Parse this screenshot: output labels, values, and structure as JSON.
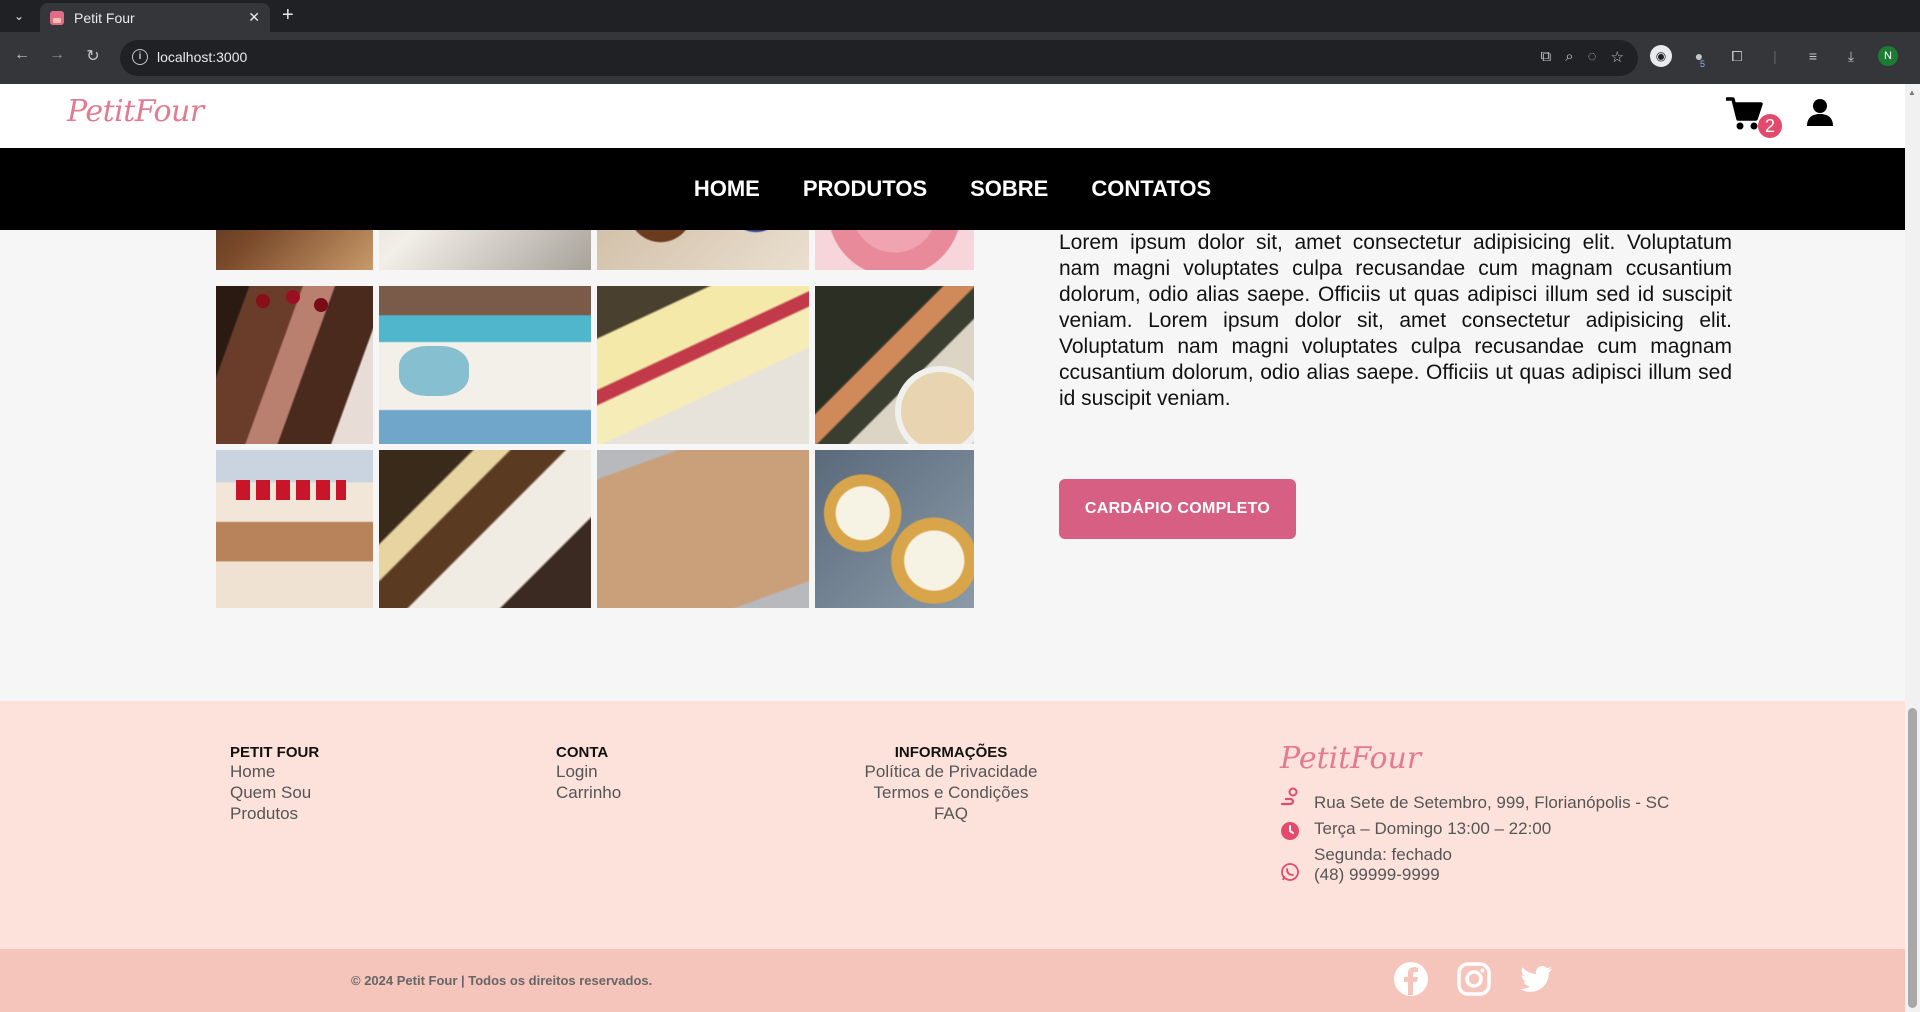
{
  "browser": {
    "tab_title": "Petit Four",
    "url": "localhost:3000",
    "profile_initial": "N",
    "extension_badge": "5"
  },
  "header": {
    "logo": "PetitFour",
    "cart_count": "2"
  },
  "nav": {
    "items": [
      "HOME",
      "PRODUTOS",
      "SOBRE",
      "CONTATOS"
    ]
  },
  "about": {
    "description": "Lorem ipsum dolor sit, amet consectetur adipisicing elit. Voluptatum nam magni voluptates culpa recusandae cum magnam ccusantium dolorum, odio alias saepe. Officiis ut quas adipisci illum sed id suscipit veniam. Lorem ipsum dolor sit, amet consectetur adipisicing elit. Voluptatum nam magni voluptates culpa recusandae cum magnam ccusantium dolorum, odio alias saepe. Officiis ut quas adipisci illum sed id suscipit veniam.",
    "cta_label": "CARDÁPIO COMPLETO"
  },
  "footer": {
    "col1": {
      "title": "PETIT FOUR",
      "links": [
        "Home",
        "Quem Sou",
        "Produtos"
      ]
    },
    "col2": {
      "title": "CONTA",
      "links": [
        "Login",
        "Carrinho"
      ]
    },
    "col3": {
      "title": "INFORMAÇÕES",
      "links": [
        "Política de Privacidade",
        "Termos e Condições",
        "FAQ"
      ]
    },
    "logo": "PetitFour",
    "address": "Rua Sete de Setembro, 999, Florianópolis - SC",
    "hours_line1": "Terça – Domingo 13:00 – 22:00",
    "hours_line2": "Segunda: fechado",
    "phone": "(48) 99999-9999",
    "copyright": "© 2024 Petit Four | Todos os direitos reservados."
  },
  "colors": {
    "brand_pink": "#e27b91",
    "cta": "#d85f84",
    "footer_bg": "#fde2dc",
    "bottom_bar": "#f5c4bb"
  }
}
